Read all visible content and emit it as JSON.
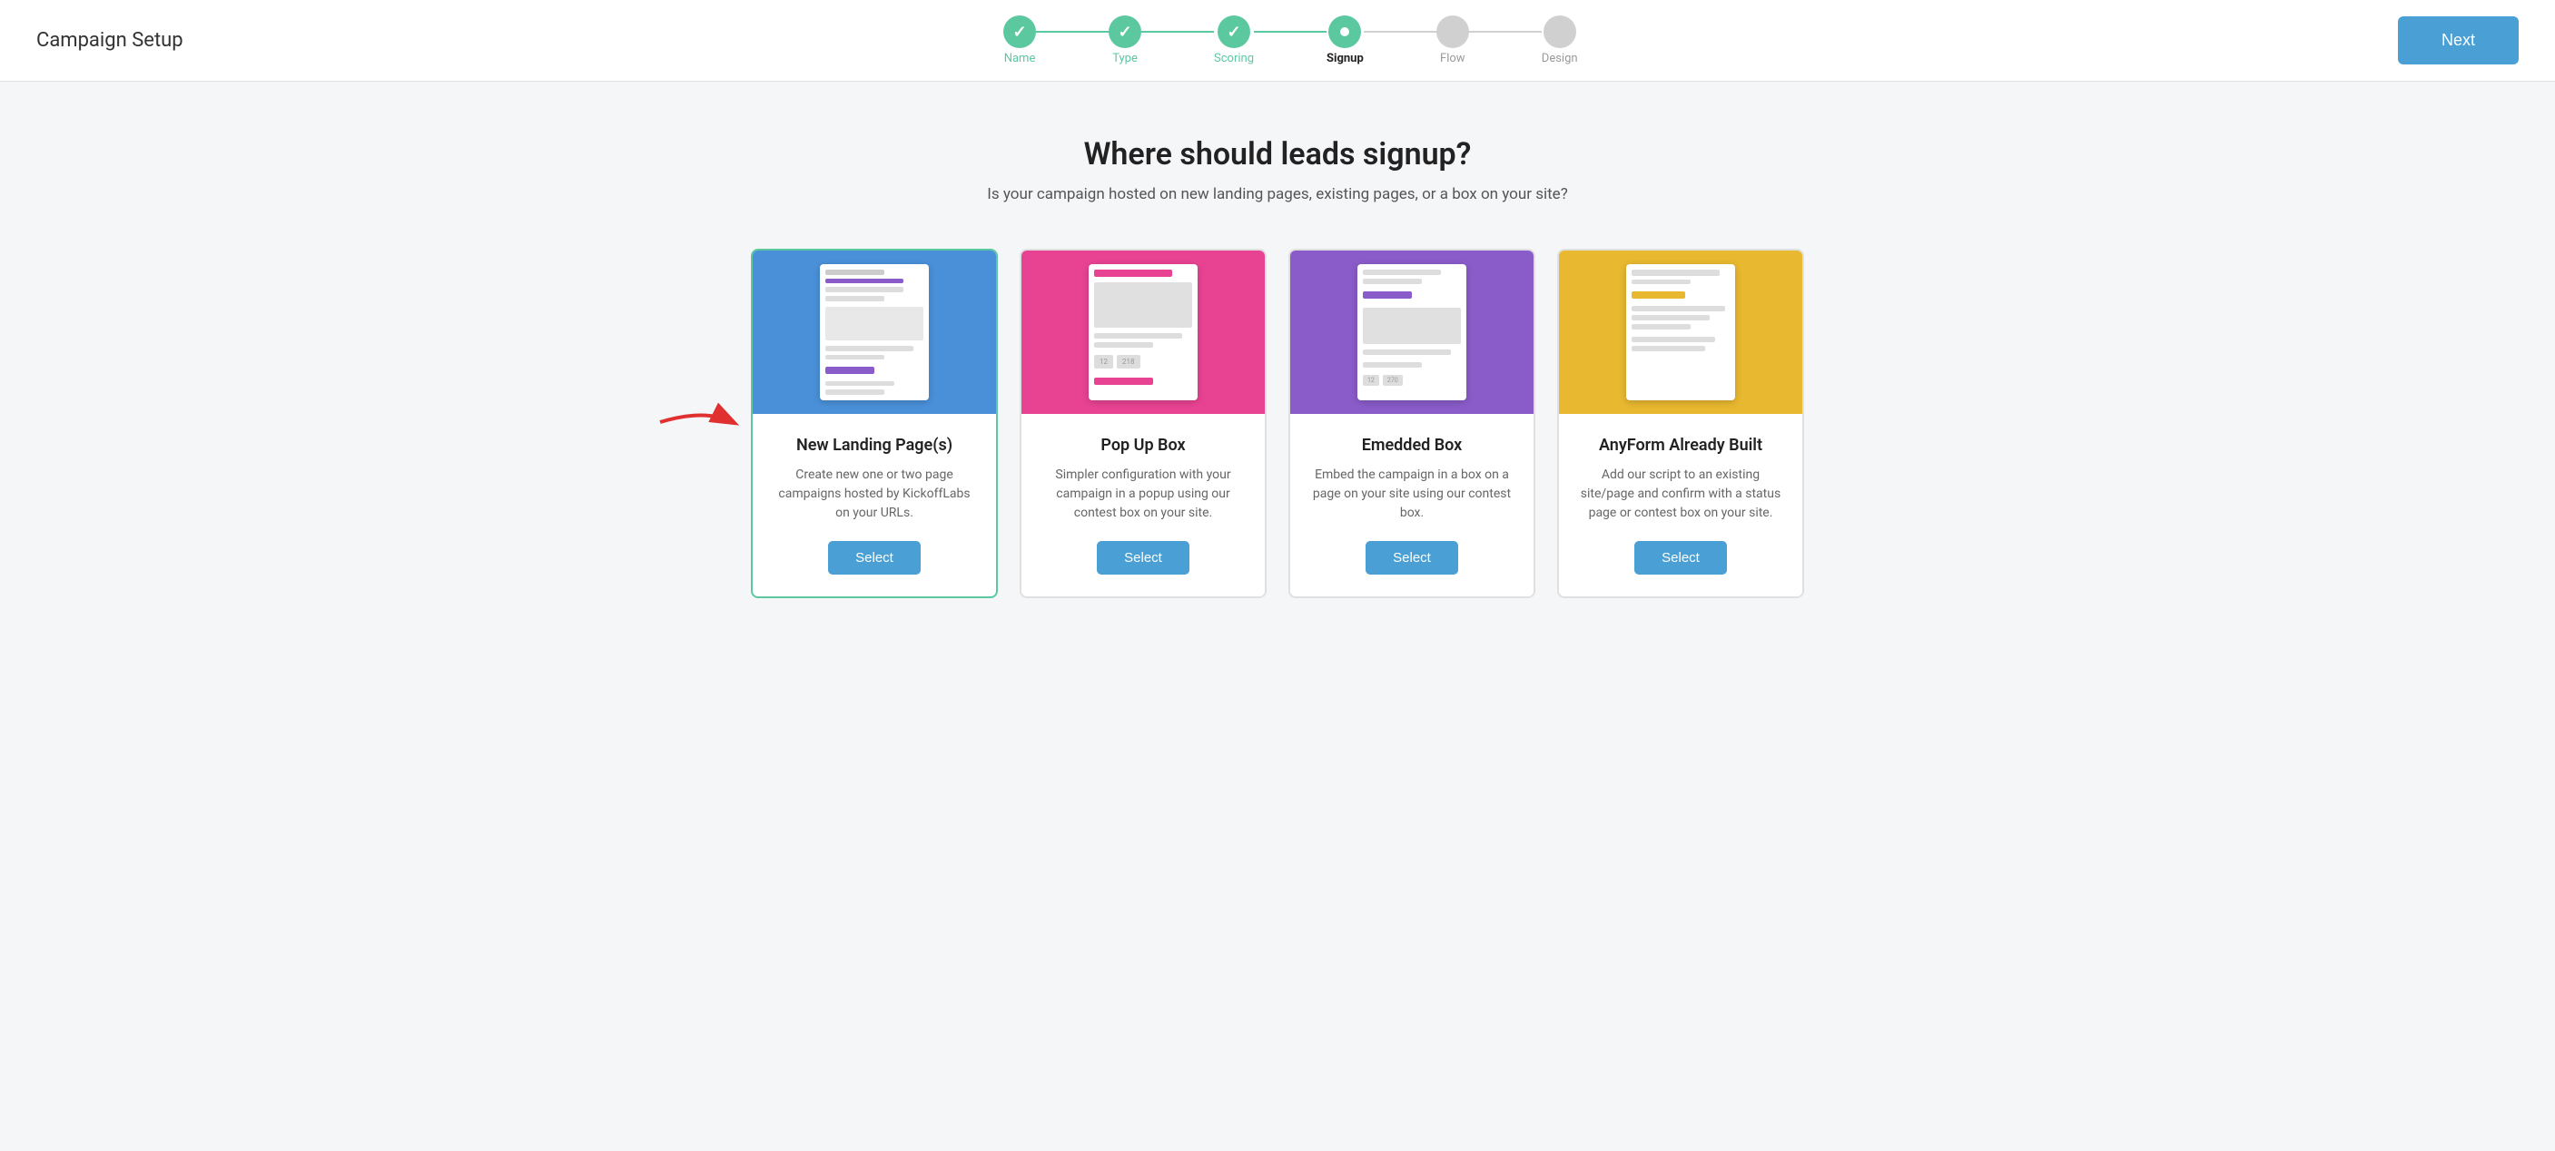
{
  "header": {
    "title": "Campaign Setup",
    "next_button": "Next"
  },
  "stepper": {
    "steps": [
      {
        "id": "name",
        "label": "Name",
        "state": "completed"
      },
      {
        "id": "type",
        "label": "Type",
        "state": "completed"
      },
      {
        "id": "scoring",
        "label": "Scoring",
        "state": "completed"
      },
      {
        "id": "signup",
        "label": "Signup",
        "state": "active"
      },
      {
        "id": "flow",
        "label": "Flow",
        "state": "inactive"
      },
      {
        "id": "design",
        "label": "Design",
        "state": "inactive"
      }
    ]
  },
  "page": {
    "heading": "Where should leads signup?",
    "subheading": "Is your campaign hosted on new landing pages, existing pages, or a box on your site?"
  },
  "cards": [
    {
      "id": "new-landing",
      "title": "New Landing Page(s)",
      "description": "Create new one or two page campaigns hosted by KickoffLabs on your URLs.",
      "select_label": "Select",
      "theme": "blue",
      "selected": true
    },
    {
      "id": "popup",
      "title": "Pop Up Box",
      "description": "Simpler configuration with your campaign in a popup using our contest box on your site.",
      "select_label": "Select",
      "theme": "pink",
      "selected": false
    },
    {
      "id": "embedded",
      "title": "Emedded Box",
      "description": "Embed the campaign in a box on a page on your site using our contest box.",
      "select_label": "Select",
      "theme": "purple",
      "selected": false
    },
    {
      "id": "anyform",
      "title": "AnyForm Already Built",
      "description": "Add our script to an existing site/page and confirm with a status page or contest box on your site.",
      "select_label": "Select",
      "theme": "yellow",
      "selected": false
    }
  ]
}
